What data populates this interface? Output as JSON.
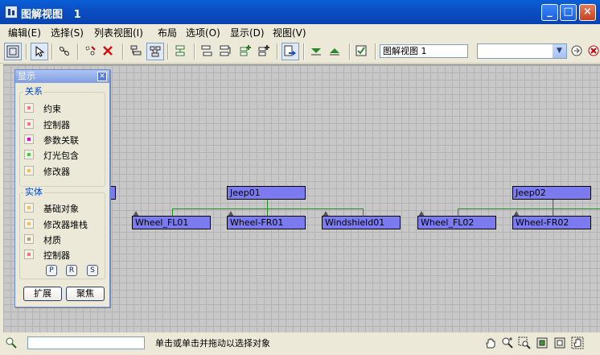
{
  "window": {
    "title": "图解视图   1"
  },
  "menu": [
    "编辑(E)",
    "选择(S)",
    "列表视图(I)",
    "布局",
    "选项(O)",
    "显示(D)",
    "视图(V)"
  ],
  "toolbar": {
    "view_name": "图解视图 1",
    "combo_value": ""
  },
  "panel": {
    "title": "显示",
    "relations_label": "关系",
    "relations": [
      {
        "label": "约束",
        "color": "#f07a7a"
      },
      {
        "label": "控制器",
        "color": "#f07a7a"
      },
      {
        "label": "参数关联",
        "color": "#e000e0"
      },
      {
        "label": "灯光包含",
        "color": "#30e030"
      },
      {
        "label": "修改器",
        "color": "#f0c060"
      }
    ],
    "entities_label": "实体",
    "entities": [
      {
        "label": "基础对象",
        "color": "#f0c060"
      },
      {
        "label": "修改器堆栈",
        "color": "#f0c060"
      },
      {
        "label": "材质",
        "color": "#b0a070"
      },
      {
        "label": "控制器",
        "color": "#f07a7a"
      }
    ],
    "pos_buttons": [
      "P",
      "R",
      "S"
    ],
    "expand_label": "扩展",
    "focus_label": "聚焦"
  },
  "nodes": {
    "jeep01": "Jeep01",
    "jeep02": "Jeep02",
    "wheel_fl01": "Wheel_FL01",
    "wheel_fr01": "Wheel-FR01",
    "windshield01": "Windshield01",
    "wheel_fl02": "Wheel_FL02",
    "wheel_fr02": "Wheel-FR02"
  },
  "status": {
    "message": "单击或单击并拖动以选择对象",
    "input_value": ""
  }
}
